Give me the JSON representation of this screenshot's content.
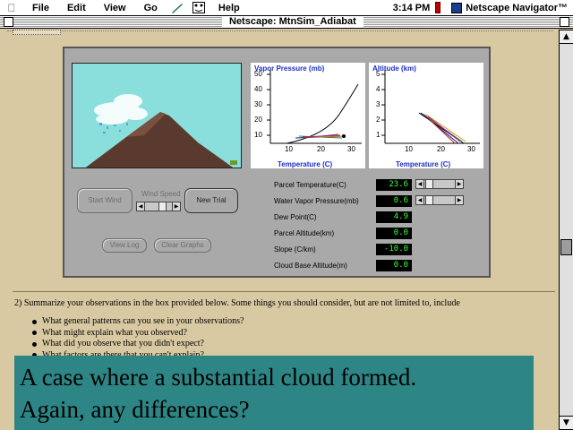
{
  "menubar": {
    "items": [
      "File",
      "Edit",
      "View",
      "Go",
      "Help"
    ],
    "clock": "3:14 PM",
    "app_name": "Netscape Navigator™"
  },
  "window": {
    "title": "Netscape: MtnSim_Adiabat"
  },
  "applet": {
    "vapor_graph": {
      "title": "Vapor Pressure (mb)",
      "xlabel": "Temperature (C)",
      "y_ticks": [
        "50",
        "40",
        "30",
        "20",
        "10"
      ],
      "x_ticks": [
        "10",
        "20",
        "30"
      ]
    },
    "altitude_graph": {
      "title": "Altitude (km)",
      "xlabel": "Temperature (C)",
      "y_ticks": [
        "5",
        "4",
        "3",
        "2",
        "1"
      ],
      "x_ticks": [
        "10",
        "20",
        "30"
      ]
    },
    "buttons": {
      "start_wind": "Start Wind",
      "wind_speed": "Wind Speed",
      "new_trial": "New Trial",
      "view_log": "View Log",
      "clear_graphs": "Clear Graphs"
    },
    "readouts": [
      {
        "label": "Parcel Temperature(C)",
        "value": "23.6"
      },
      {
        "label": "Water Vapor Pressure(mb)",
        "value": "0.6"
      },
      {
        "label": "Dew Point(C)",
        "value": "4.9"
      },
      {
        "label": "Parcel Altitude(km)",
        "value": "0.0"
      },
      {
        "label": "Slope (C/km)",
        "value": "-10.0"
      },
      {
        "label": "Cloud Base Altitude(m)",
        "value": "0.0"
      }
    ]
  },
  "page": {
    "question": "2) Summarize your observations in the box provided below.   Some things you should consider, but are not limited to, include",
    "bullets": [
      "What general patterns can you see in your observations?",
      "What might explain what you observed?",
      "What did you observe that you didn't expect?",
      "What factors are there that you can't explain?"
    ]
  },
  "caption": {
    "line1": "A case where a substantial cloud formed.",
    "line2": "Again, any differences?"
  },
  "colors": {
    "page_bg": "#d9c9a3",
    "applet_bg": "#a9a9a9",
    "sky": "#8adfdc",
    "graph_label": "#1f2fc4",
    "readout_text": "#3aff3a",
    "caption_bg": "#2e8585"
  }
}
